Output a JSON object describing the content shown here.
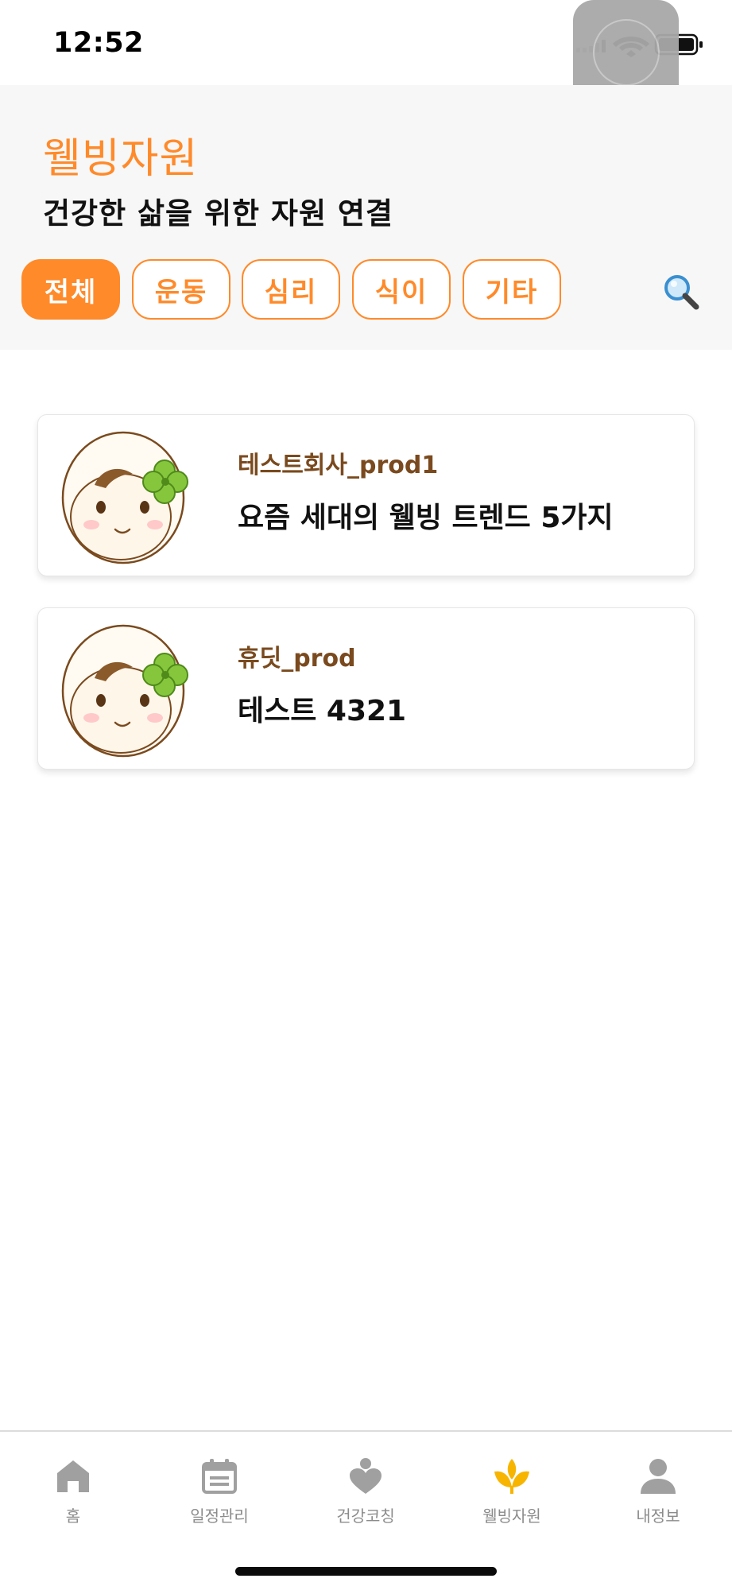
{
  "status_bar": {
    "time": "12:52"
  },
  "header": {
    "title": "웰빙자원",
    "subtitle": "건강한 삶을 위한 자원 연결",
    "chips": [
      {
        "label": "전체",
        "active": true
      },
      {
        "label": "운동",
        "active": false
      },
      {
        "label": "심리",
        "active": false
      },
      {
        "label": "식이",
        "active": false
      },
      {
        "label": "기타",
        "active": false
      }
    ],
    "search_icon": "search-icon"
  },
  "resources": [
    {
      "org": "테스트회사_prod1",
      "title": "요즘 세대의 웰빙 트렌드 5가지",
      "avatar": "clover-girl-avatar"
    },
    {
      "org": "휴딧_prod",
      "title": "테스트 4321",
      "avatar": "clover-girl-avatar"
    }
  ],
  "bottom_nav": [
    {
      "label": "홈",
      "icon": "home-icon",
      "active": false
    },
    {
      "label": "일정관리",
      "icon": "calendar-icon",
      "active": false
    },
    {
      "label": "건강코칭",
      "icon": "heart-person-icon",
      "active": false
    },
    {
      "label": "웰빙자원",
      "icon": "sprout-icon",
      "active": true
    },
    {
      "label": "내정보",
      "icon": "person-icon",
      "active": false
    }
  ],
  "colors": {
    "accent": "#ff8a2a",
    "org_text": "#7a4a1e",
    "nav_inactive": "#a0a0a0",
    "nav_active": "#f7b500"
  }
}
